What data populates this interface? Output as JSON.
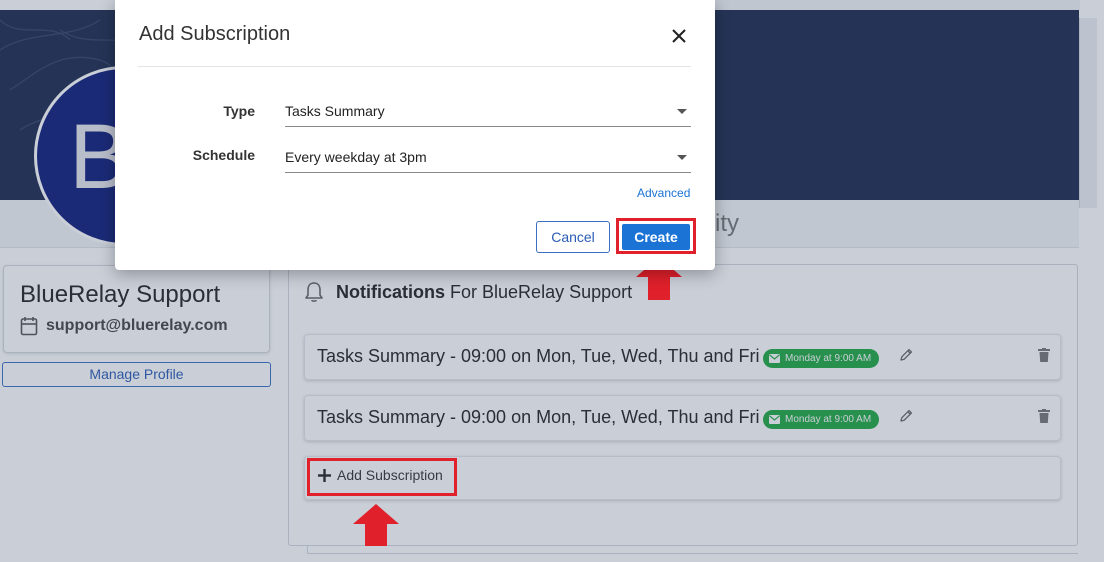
{
  "background": {
    "tab_fragment": "ity",
    "avatar_letter": "B",
    "profile": {
      "name": "BlueRelay Support",
      "email": "support@bluerelay.com",
      "manage_label": "Manage Profile"
    },
    "notifications": {
      "title_bold": "Notifications",
      "title_rest": "For BlueRelay Support",
      "subscriptions": [
        {
          "title": "Tasks Summary - 09:00 on Mon, Tue, Wed, Thu and Fri",
          "badge": "Monday at 9:00 AM"
        },
        {
          "title": "Tasks Summary - 09:00 on Mon, Tue, Wed, Thu and Fri",
          "badge": "Monday at 9:00 AM"
        }
      ],
      "add_label": "Add Subscription"
    }
  },
  "dialog": {
    "title": "Add Subscription",
    "type_label": "Type",
    "type_value": "Tasks Summary",
    "schedule_label": "Schedule",
    "schedule_value": "Every weekday at 3pm",
    "advanced_label": "Advanced",
    "cancel_label": "Cancel",
    "create_label": "Create"
  },
  "colors": {
    "banner": "#1d2a4d",
    "primary": "#1b73d6",
    "badge_green": "#1eaa3f",
    "highlight_red": "#e0202a",
    "avatar": "#0f1c7a"
  },
  "icons": [
    "bell-icon",
    "calendar-icon",
    "mail-icon",
    "pencil-icon",
    "trash-icon",
    "plus-icon",
    "close-icon",
    "chevron-down-icon",
    "arrow-up-icon"
  ]
}
